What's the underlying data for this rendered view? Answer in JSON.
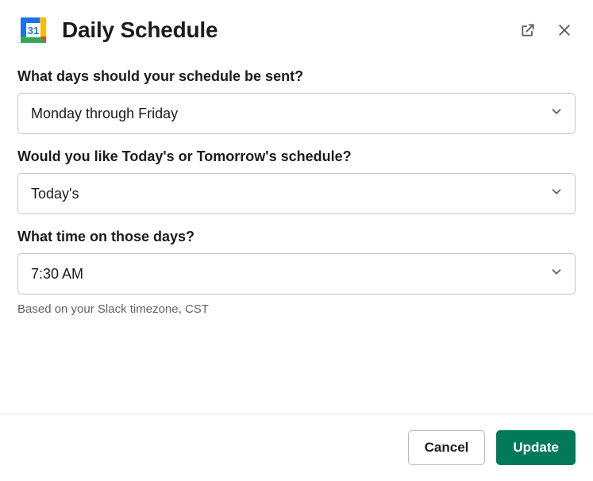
{
  "header": {
    "title": "Daily Schedule",
    "app_icon_day": "31"
  },
  "fields": {
    "days": {
      "label": "What days should your schedule be sent?",
      "value": "Monday through Friday"
    },
    "which": {
      "label": "Would you like Today's or Tomorrow's schedule?",
      "value": "Today's"
    },
    "time": {
      "label": "What time on those days?",
      "value": "7:30 AM",
      "helper": "Based on your Slack timezone, CST"
    }
  },
  "footer": {
    "cancel_label": "Cancel",
    "submit_label": "Update"
  }
}
